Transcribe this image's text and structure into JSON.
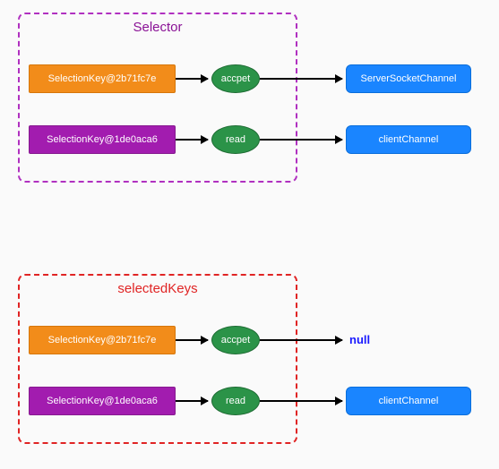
{
  "groups": {
    "selector": {
      "title": "Selector",
      "titleColor": "#8a1296",
      "borderColor": "#b030c0",
      "rows": [
        {
          "key": "SelectionKey@2b71fc7e",
          "keyBg": "#f28c1a",
          "keyBorder": "#d6760a",
          "op": "accpet",
          "channel": "ServerSocketChannel"
        },
        {
          "key": "SelectionKey@1de0aca6",
          "keyBg": "#a21caf",
          "keyBorder": "#86198f",
          "op": "read",
          "channel": "clientChannel"
        }
      ]
    },
    "selectedKeys": {
      "title": "selectedKeys",
      "titleColor": "#e02424",
      "borderColor": "#e02424",
      "rows": [
        {
          "key": "SelectionKey@2b71fc7e",
          "keyBg": "#f28c1a",
          "keyBorder": "#d6760a",
          "op": "accpet",
          "channel": null,
          "null_label": "null"
        },
        {
          "key": "SelectionKey@1de0aca6",
          "keyBg": "#a21caf",
          "keyBorder": "#86198f",
          "op": "read",
          "channel": "clientChannel"
        }
      ]
    }
  }
}
